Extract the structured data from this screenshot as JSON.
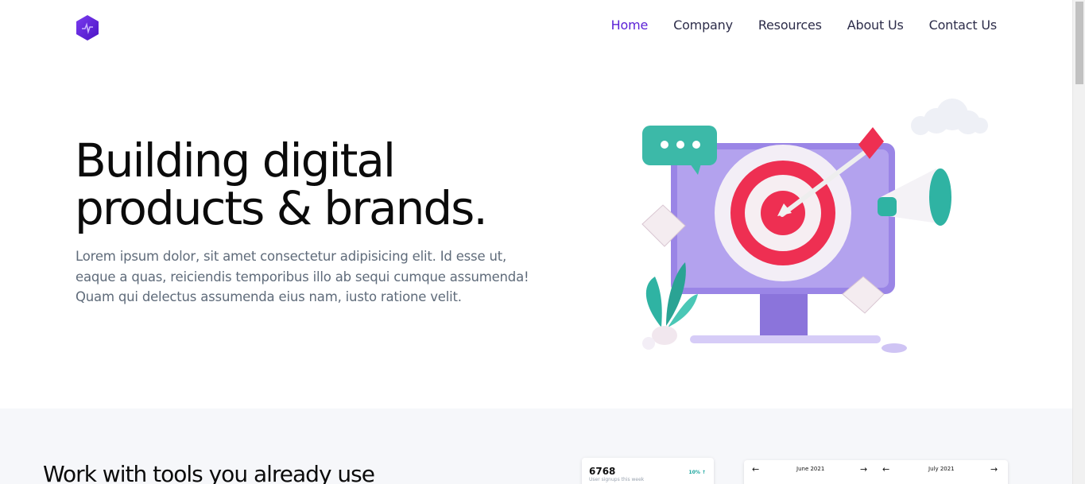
{
  "nav": {
    "items": [
      {
        "label": "Home",
        "active": true
      },
      {
        "label": "Company",
        "active": false
      },
      {
        "label": "Resources",
        "active": false
      },
      {
        "label": "About Us",
        "active": false
      },
      {
        "label": "Contact Us",
        "active": false
      }
    ]
  },
  "hero": {
    "title_line1": "Building digital",
    "title_line2": "products & brands.",
    "body": "Lorem ipsum dolor, sit amet consectetur adipisicing elit. Id esse ut, eaque a quas, reiciendis temporibus illo ab sequi cumque assumenda! Quam qui delectus assumenda eius nam, iusto ratione velit."
  },
  "tools": {
    "heading": "Work with tools you already use",
    "stat_card": {
      "value": "6768",
      "label": "User signups this week",
      "change": "10% ↑"
    },
    "calendar": {
      "month1": "June 2021",
      "month2": "July 2021",
      "prev": "←",
      "next": "→"
    }
  },
  "colors": {
    "accent": "#5b21d6",
    "nav_text": "#2d2d4a",
    "body_text": "#5f6b7a",
    "section_bg": "#f6f7fa"
  }
}
